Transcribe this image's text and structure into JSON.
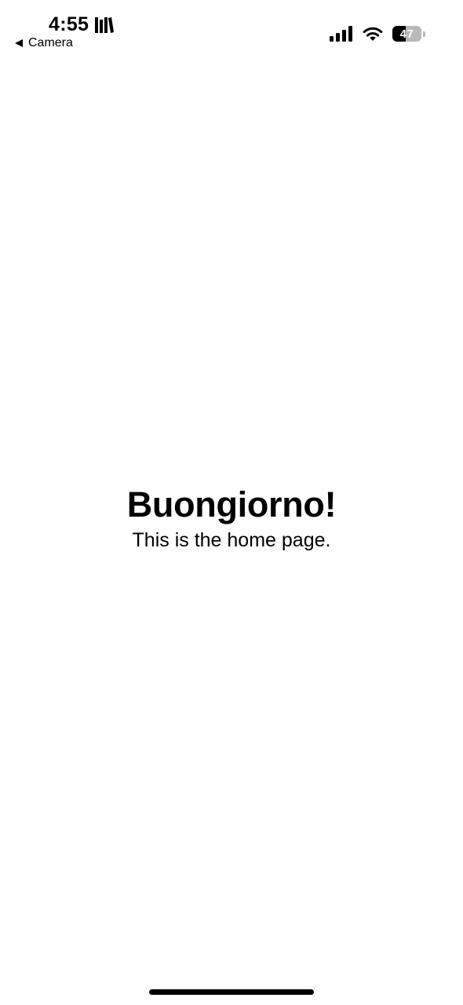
{
  "status_bar": {
    "time": "4:55",
    "back_app_label": "Camera",
    "battery_level": "47",
    "icons": [
      "books-icon",
      "back-arrow-icon",
      "cellular-signal-icon",
      "wifi-icon",
      "battery-icon"
    ]
  },
  "page": {
    "heading": "Buongiorno!",
    "subtitle": "This is the home page."
  },
  "colors": {
    "background": "#ffffff",
    "text": "#000000",
    "battery_empty": "#b9b9b9"
  }
}
